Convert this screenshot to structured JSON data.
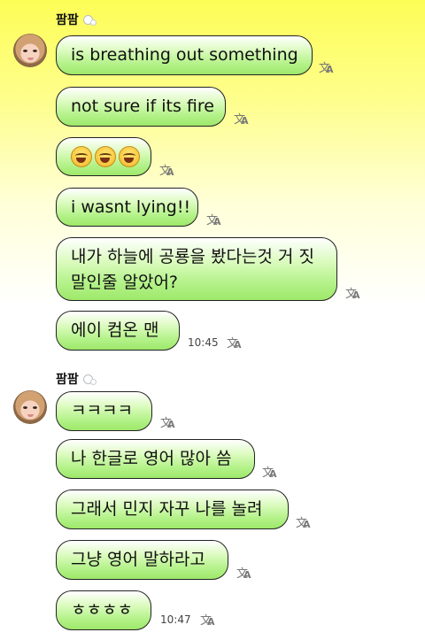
{
  "groups": [
    {
      "sender": "팜팜",
      "messages": [
        {
          "text": "is breathing out something"
        },
        {
          "text": "not sure if its fire"
        },
        {
          "text": "",
          "emoji_count": 3
        },
        {
          "text": "i wasnt lying!!"
        },
        {
          "text": "내가 하늘에 공룡을 봤다는것 거 짓말인줄 알았어?"
        },
        {
          "text": "에이 컴온 맨",
          "time": "10:45"
        }
      ]
    },
    {
      "sender": "팜팜",
      "messages": [
        {
          "text": "ㅋㅋㅋㅋ"
        },
        {
          "text": "나 한글로 영어 많아 씀"
        },
        {
          "text": "그래서 민지 자꾸 나를 놀려"
        },
        {
          "text": "그냥 영어 말하라고"
        },
        {
          "text": "ㅎㅎㅎㅎ",
          "time": "10:47"
        }
      ]
    }
  ],
  "translate_icon": "translate-icon",
  "emoji_icon": "laughing-emoji-icon"
}
